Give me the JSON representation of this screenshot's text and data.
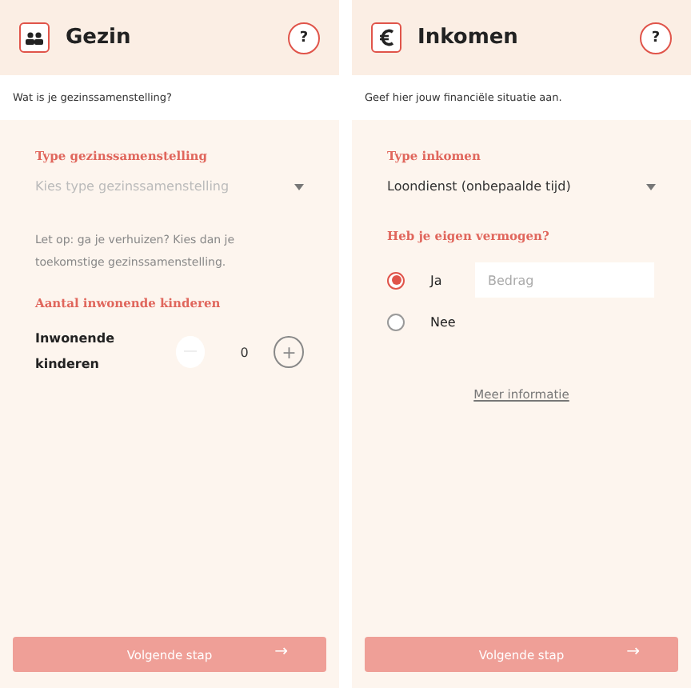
{
  "panels": [
    {
      "header": {
        "title": "Gezin",
        "help": "?"
      },
      "subtitle": "Wat is je gezinssamenstelling?",
      "fields": [
        {
          "kind": "select",
          "label": "Type gezinssamenstelling",
          "placeholder": "Kies type gezinssamenstelling"
        },
        {
          "kind": "note",
          "text": "Let op: ga je verhuizen? Kies dan je toekomstige gezinssamenstelling."
        },
        {
          "kind": "counter",
          "label": "Aantal inwonende kinderen",
          "item": "Inwonende kinderen",
          "value": "0",
          "minus_disabled": true,
          "plus": "+"
        }
      ],
      "button": {
        "label": "Volgende stap",
        "arrow": "→"
      }
    },
    {
      "header": {
        "title": "Inkomen",
        "help": "?"
      },
      "subtitle": "Geef hier jouw financiële situatie aan.",
      "fields": [
        {
          "kind": "select",
          "label": "Type inkomen",
          "value": "Loondienst (onbepaalde tijd)"
        },
        {
          "kind": "radio",
          "label": "Heb je eigen vermogen?",
          "options": [
            {
              "label": "Ja",
              "selected": true,
              "placeholder": "Bedrag"
            },
            {
              "label": "Nee",
              "selected": false
            }
          ]
        },
        {
          "kind": "link",
          "text": "Meer informatie"
        }
      ],
      "button": {
        "label": "Volgende stap",
        "arrow": "→"
      }
    }
  ]
}
